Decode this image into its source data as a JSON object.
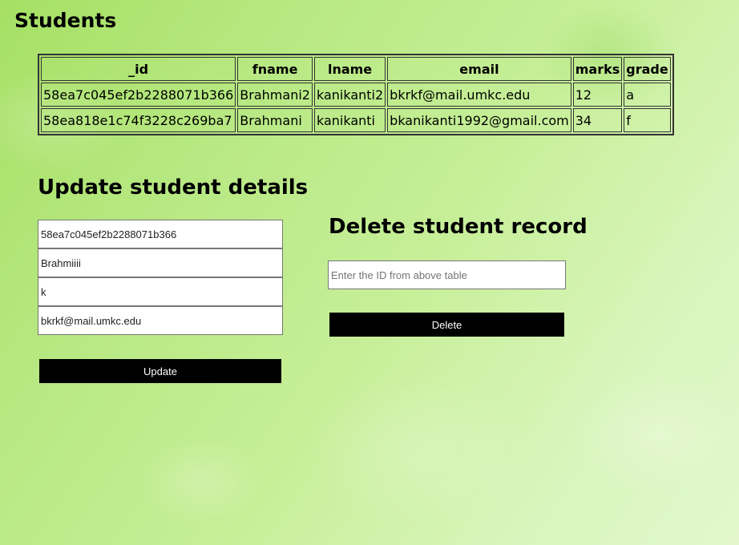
{
  "students": {
    "title": "Students",
    "columns": [
      "_id",
      "fname",
      "lname",
      "email",
      "marks",
      "grade"
    ],
    "rows": [
      [
        "58ea7c045ef2b2288071b366",
        "Brahmani2",
        "kanikanti2",
        "bkrkf@mail.umkc.edu",
        "12",
        "a"
      ],
      [
        "58ea818e1c74f3228c269ba7",
        "Brahmani",
        "kanikanti",
        "bkanikanti1992@gmail.com",
        "34",
        "f"
      ]
    ]
  },
  "update": {
    "title": "Update student details",
    "id_value": "58ea7c045ef2b2288071b366",
    "fname_value": "Brahmiiii",
    "lname_value": "k",
    "email_value": "bkrkf@mail.umkc.edu",
    "button_label": "Update"
  },
  "delete": {
    "title": "Delete student record",
    "placeholder": "Enter the ID from above table",
    "button_label": "Delete"
  }
}
